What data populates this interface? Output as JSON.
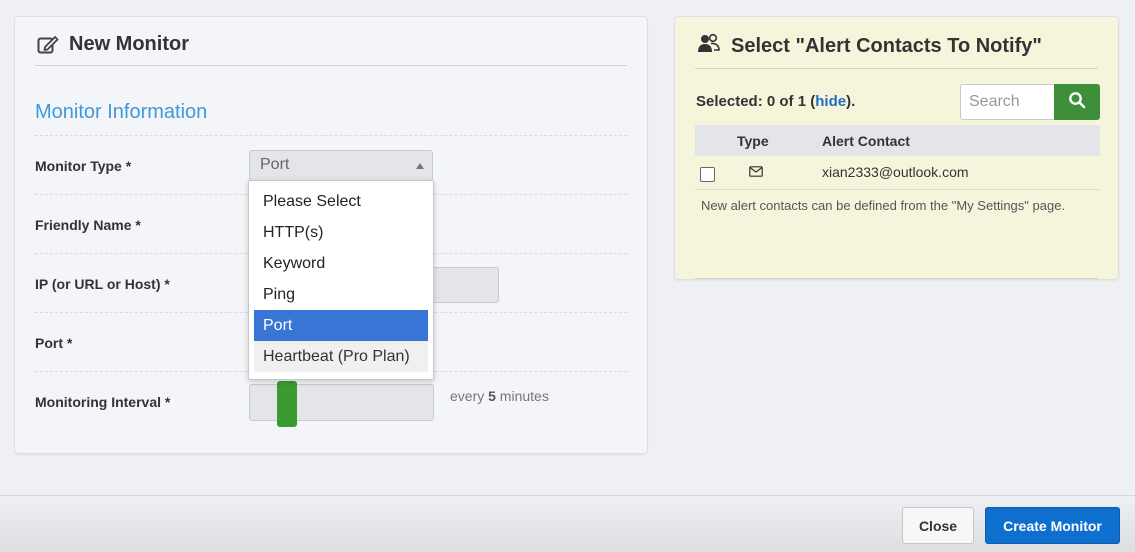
{
  "left_panel": {
    "title": "New Monitor",
    "title_icon": "edit-icon",
    "section_title": "Monitor Information",
    "fields": {
      "monitor_type_label": "Monitor Type *",
      "monitor_type_value": "Port",
      "friendly_name_label": "Friendly Name *",
      "ip_label": "IP (or URL or Host) *",
      "port_label": "Port *",
      "interval_label": "Monitoring Interval *",
      "interval_prefix": "every ",
      "interval_value": "5",
      "interval_suffix": " minutes"
    },
    "monitor_type_options": [
      "Please Select",
      "HTTP(s)",
      "Keyword",
      "Ping",
      "Port",
      "Heartbeat (Pro Plan)"
    ],
    "selected_option": "Port"
  },
  "right_panel": {
    "title": "Select \"Alert Contacts To Notify\"",
    "title_icon": "users-icon",
    "selected_prefix": "Selected: ",
    "selected_count": "0 of 1",
    "hide_link": "hide",
    "search_placeholder": "Search",
    "table_headers": {
      "checkbox": "",
      "type": "Type",
      "contact": "Alert Contact"
    },
    "contacts": [
      {
        "type_icon": "envelope-icon",
        "contact": "xian2333@outlook.com"
      }
    ],
    "note": "New alert contacts can be defined from the \"My Settings\" page."
  },
  "footer": {
    "close_label": "Close",
    "create_label": "Create Monitor"
  },
  "colors": {
    "accent_blue": "#3e9ad8",
    "link_blue": "#1f6cc0",
    "primary_button": "#0f6fcf",
    "search_button": "#3f8f3a",
    "slider_handle": "#3a9b2f",
    "option_highlight": "#3875d7",
    "contacts_panel_bg": "#f5f5dc"
  }
}
